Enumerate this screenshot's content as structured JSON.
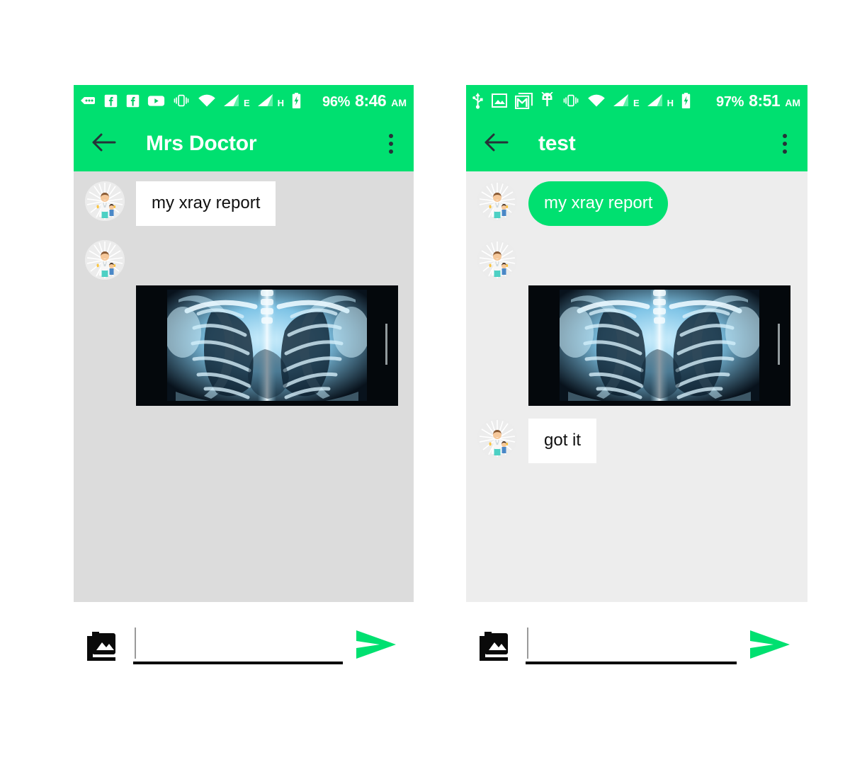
{
  "theme": {
    "accent": "#00e070",
    "appbar_text": "#ffffff",
    "icon_dark": "#263238",
    "chat_bg_left": "#dcdcdc",
    "chat_bg_right": "#ededed",
    "bubble_plain_bg": "#ffffff",
    "bubble_plain_text": "#101010",
    "bubble_accent_bg": "#00e070",
    "bubble_accent_text": "#ffffff",
    "composer_bg": "#ffffff",
    "underline": "#050505"
  },
  "screens": [
    {
      "id": "screen-left",
      "statusbar": {
        "icons": [
          "message-icon",
          "facebook-icon",
          "facebook-icon",
          "youtube-icon",
          "vibrate-icon",
          "wifi-icon",
          "signal-icon",
          "signal-icon",
          "battery-charging-icon"
        ],
        "signal_labels": [
          "E",
          "H"
        ],
        "battery_percent": "96%",
        "time": "8:46",
        "ampm": "AM"
      },
      "appbar": {
        "back_icon": "back-arrow-icon",
        "title": "Mrs Doctor",
        "overflow_icon": "overflow-menu-icon"
      },
      "messages": [
        {
          "type": "text",
          "author_avatar": "doctor-avatar",
          "style": "plain",
          "text": "my xray report"
        },
        {
          "type": "image",
          "author_avatar": "doctor-avatar",
          "alt": "chest-xray-image"
        }
      ],
      "composer": {
        "gallery_icon": "photo-library-icon",
        "input_value": "",
        "input_placeholder": "",
        "send_icon": "send-icon"
      }
    },
    {
      "id": "screen-right",
      "statusbar": {
        "icons": [
          "usb-icon",
          "photo-icon",
          "gmail-icon",
          "android-icon",
          "vibrate-icon",
          "wifi-icon",
          "signal-icon",
          "signal-icon",
          "battery-charging-icon"
        ],
        "signal_labels": [
          "E",
          "H"
        ],
        "battery_percent": "97%",
        "time": "8:51",
        "ampm": "AM"
      },
      "appbar": {
        "back_icon": "back-arrow-icon",
        "title": "test",
        "overflow_icon": "overflow-menu-icon"
      },
      "messages": [
        {
          "type": "text",
          "author_avatar": "doctor-avatar",
          "style": "accent",
          "text": "my xray report"
        },
        {
          "type": "image",
          "author_avatar": "doctor-avatar",
          "alt": "chest-xray-image"
        },
        {
          "type": "text",
          "author_avatar": "doctor-avatar",
          "style": "plain",
          "text": "got it"
        }
      ],
      "composer": {
        "gallery_icon": "photo-library-icon",
        "input_value": "",
        "input_placeholder": "",
        "send_icon": "send-icon"
      }
    }
  ]
}
